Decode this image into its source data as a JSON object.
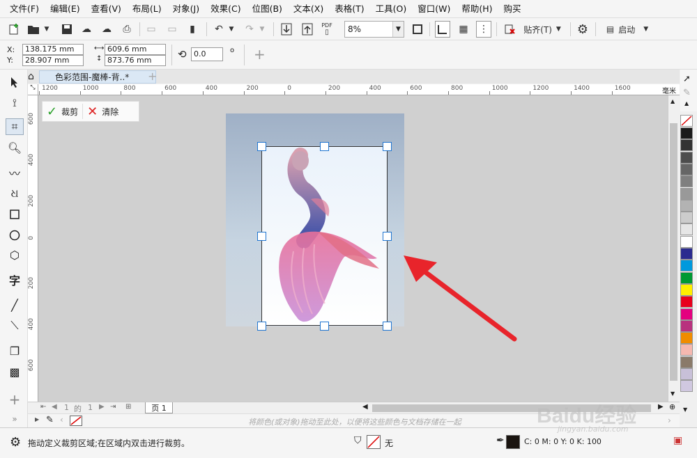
{
  "menu": [
    "文件(F)",
    "编辑(E)",
    "查看(V)",
    "布局(L)",
    "对象(J)",
    "效果(C)",
    "位图(B)",
    "文本(X)",
    "表格(T)",
    "工具(O)",
    "窗口(W)",
    "帮助(H)",
    "购买"
  ],
  "toolbar": {
    "zoom_value": "8%",
    "snap_label": "贴齐(T)",
    "launch_label": "启动",
    "pdf_label": "PDF"
  },
  "props": {
    "x_label": "X:",
    "y_label": "Y:",
    "x_value": "138.175 mm",
    "y_value": "28.907 mm",
    "width_value": "609.6 mm",
    "height_value": "873.76 mm",
    "rotation_value": "0.0",
    "degree_symbol": "o"
  },
  "document": {
    "tab_title": "色彩范围-魔棒-背..*"
  },
  "ruler": {
    "unit": "毫米",
    "h_ticks": [
      "1200",
      "1000",
      "800",
      "600",
      "400",
      "200",
      "0",
      "200",
      "400",
      "600",
      "800",
      "1000",
      "1200",
      "1400",
      "1600"
    ],
    "v_ticks": [
      "600",
      "400",
      "200",
      "0",
      "200",
      "400",
      "600"
    ]
  },
  "crop_toolbar": {
    "crop_label": "裁剪",
    "clear_label": "清除"
  },
  "page_nav": {
    "current": "1",
    "of_label": "的",
    "total": "1",
    "page_tab": "页 1"
  },
  "doc_palette": {
    "hint": "将颜色(或对象)拖动至此处，以便将这些颜色与文档存储在一起"
  },
  "status": {
    "message": "拖动定义裁剪区域;在区域内双击进行裁剪。",
    "fill_label": "无",
    "cmyk": "C: 0 M: 0 Y: 0 K: 100"
  },
  "palette_colors": [
    "#1a1a1a",
    "#333333",
    "#4d4d4d",
    "#666666",
    "#7f7f7f",
    "#999999",
    "#b3b3b3",
    "#cccccc",
    "#e6e6e6",
    "#ffffff",
    "#2b2b8f",
    "#0099dd",
    "#009933",
    "#ffee00",
    "#e8001c",
    "#e4007f",
    "#b8327e",
    "#f08c00",
    "#f5b8b0",
    "#8a7a6a",
    "#c8c0d8",
    "#d0c8e0"
  ],
  "watermark": {
    "brand": "Baidu经验",
    "url": "jingyan.baidu.com"
  }
}
